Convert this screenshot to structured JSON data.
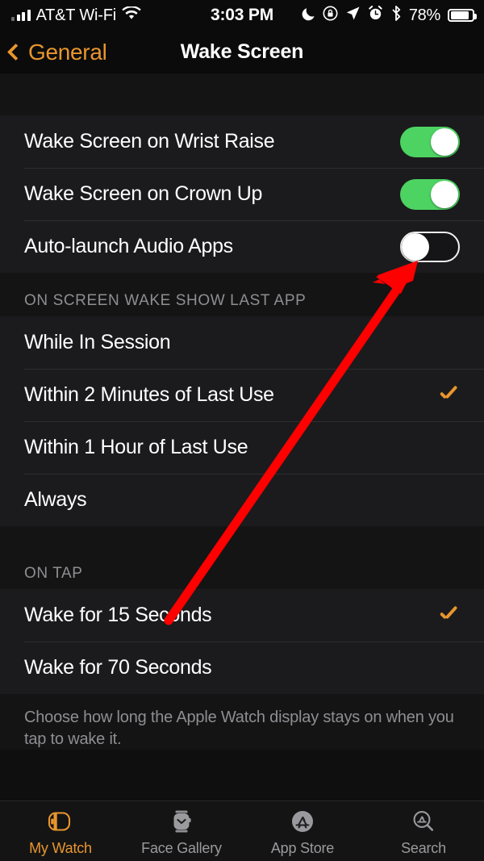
{
  "status_bar": {
    "carrier": "AT&T Wi-Fi",
    "time": "3:03 PM",
    "battery_percent": "78%",
    "icons": [
      "signal-bars-icon",
      "wifi-icon",
      "do-not-disturb-moon-icon",
      "rotation-lock-icon",
      "location-arrow-icon",
      "alarm-clock-icon",
      "bluetooth-icon",
      "battery-icon"
    ]
  },
  "nav": {
    "back_label": "General",
    "title": "Wake Screen"
  },
  "toggles_group": [
    {
      "label": "Wake Screen on Wrist Raise",
      "state": "on"
    },
    {
      "label": "Wake Screen on Crown Up",
      "state": "on"
    },
    {
      "label": "Auto-launch Audio Apps",
      "state": "off"
    }
  ],
  "section_wake": {
    "header": "ON SCREEN WAKE SHOW LAST APP",
    "options": [
      {
        "label": "While In Session",
        "selected": false
      },
      {
        "label": "Within 2 Minutes of Last Use",
        "selected": true
      },
      {
        "label": "Within 1 Hour of Last Use",
        "selected": false
      },
      {
        "label": "Always",
        "selected": false
      }
    ]
  },
  "section_tap": {
    "header": "ON TAP",
    "options": [
      {
        "label": "Wake for 15 Seconds",
        "selected": true
      },
      {
        "label": "Wake for 70 Seconds",
        "selected": false
      }
    ],
    "footer": "Choose how long the Apple Watch display stays on when you tap to wake it."
  },
  "tab_bar": [
    {
      "label": "My Watch",
      "icon": "watch-side-icon",
      "active": true
    },
    {
      "label": "Face Gallery",
      "icon": "watch-face-icon",
      "active": false
    },
    {
      "label": "App Store",
      "icon": "app-store-icon",
      "active": false
    },
    {
      "label": "Search",
      "icon": "search-app-store-icon",
      "active": false
    }
  ],
  "annotation": {
    "type": "red-arrow",
    "color": "#FF0000",
    "points_to": "Auto-launch Audio Apps toggle"
  },
  "colors": {
    "accent": "#E8962E",
    "toggle_on": "#4CD362",
    "arrow": "#FF0000",
    "row_bg": "#1b1b1d",
    "page_bg": "#141414"
  }
}
